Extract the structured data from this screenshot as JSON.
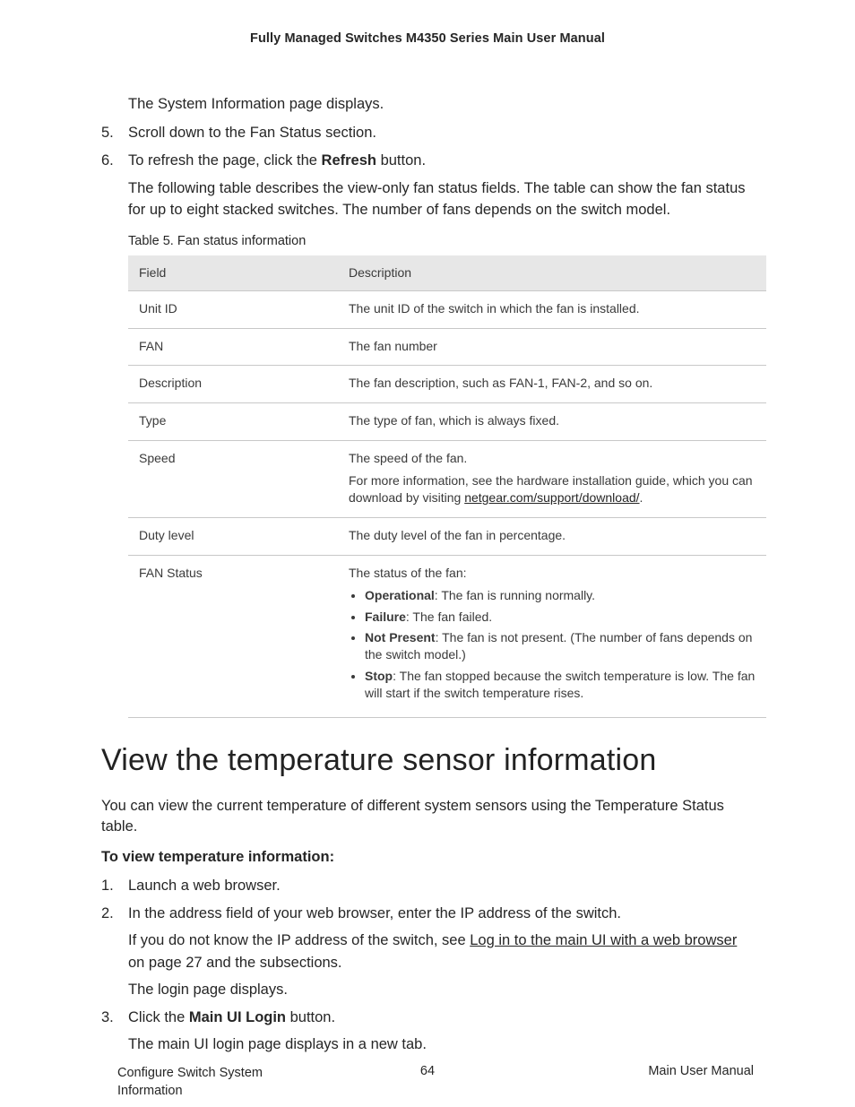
{
  "running_head": "Fully Managed Switches M4350 Series Main User Manual",
  "intro_para": "The System Information page displays.",
  "steps_top": [
    {
      "num": "5.",
      "text_pre": "Scroll down to the Fan Status section."
    },
    {
      "num": "6.",
      "text_pre": "To refresh the page, click the ",
      "bold": "Refresh",
      "text_post": " button.",
      "para": "The following table describes the view-only fan status fields. The table can show the fan status for up to eight stacked switches. The number of fans depends on the switch model."
    }
  ],
  "table_caption": "Table 5. Fan status information",
  "table": {
    "headers": [
      "Field",
      "Description"
    ],
    "rows": [
      {
        "field": "Unit ID",
        "desc": "The unit ID of the switch in which the fan is installed."
      },
      {
        "field": "FAN",
        "desc": "The fan number"
      },
      {
        "field": "Description",
        "desc": "The fan description, such as FAN-1, FAN-2, and so on."
      },
      {
        "field": "Type",
        "desc": "The type of fan, which is always fixed."
      },
      {
        "field": "Speed",
        "desc": "The speed of the fan.",
        "extra_pre": "For more information, see the hardware installation guide, which you can download by visiting ",
        "extra_link": "netgear.com/support/download/",
        "extra_post": "."
      },
      {
        "field": "Duty level",
        "desc": "The duty level of the fan in percentage."
      },
      {
        "field": "FAN Status",
        "desc": "The status of the fan:",
        "bullets": [
          {
            "b": "Operational",
            "t": ": The fan is running normally."
          },
          {
            "b": "Failure",
            "t": ": The fan failed."
          },
          {
            "b": "Not Present",
            "t": ": The fan is not present. (The number of fans depends on the switch model.)"
          },
          {
            "b": "Stop",
            "t": ": The fan stopped because the switch temperature is low. The fan will start if the switch temperature rises."
          }
        ]
      }
    ]
  },
  "section_heading": "View the temperature sensor information",
  "section_para": "You can view the current temperature of different system sensors using the Temperature Status table.",
  "subhead": "To view temperature information:",
  "steps_bottom": [
    {
      "num": "1.",
      "text_pre": "Launch a web browser."
    },
    {
      "num": "2.",
      "text_pre": "In the address field of your web browser, enter the IP address of the switch.",
      "para_pre": "If you do not know the IP address of the switch, see ",
      "para_link": "Log in to the main UI with a web browser",
      "para_post": " on page 27 and the subsections.",
      "para2": "The login page displays."
    },
    {
      "num": "3.",
      "text_pre": "Click the ",
      "bold": "Main UI Login",
      "text_post": " button.",
      "para": "The main UI login page displays in a new tab."
    }
  ],
  "footer": {
    "left": "Configure Switch System Information",
    "center": "64",
    "right": "Main User Manual"
  }
}
